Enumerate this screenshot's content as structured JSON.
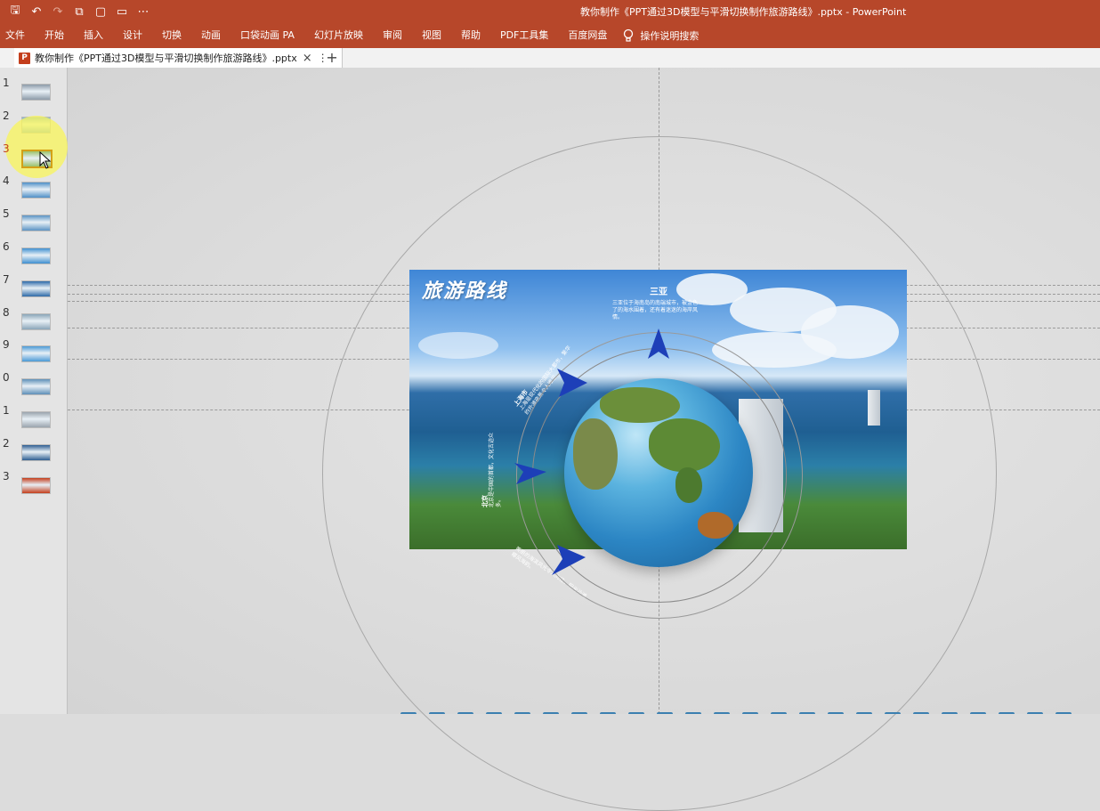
{
  "window": {
    "title": "教你制作《PPT通过3D模型与平滑切换制作旅游路线》.pptx  -  PowerPoint"
  },
  "quick_access": [
    {
      "name": "save-icon",
      "glyph": "🖫"
    },
    {
      "name": "undo-icon",
      "glyph": "↶"
    },
    {
      "name": "redo-icon",
      "glyph": "↷"
    },
    {
      "name": "slideshow-icon",
      "glyph": "⧉"
    },
    {
      "name": "new-icon",
      "glyph": "▢"
    },
    {
      "name": "open-icon",
      "glyph": "▭"
    },
    {
      "name": "customize-icon",
      "glyph": "⋯"
    }
  ],
  "ribbon": {
    "tabs": [
      "文件",
      "开始",
      "插入",
      "设计",
      "切换",
      "动画",
      "口袋动画 PA",
      "幻灯片放映",
      "审阅",
      "视图",
      "帮助",
      "PDF工具集",
      "百度网盘"
    ],
    "tell_me": "操作说明搜索"
  },
  "doc_tab": {
    "title": "教你制作《PPT通过3D模型与平滑切换制作旅游路线》.pptx",
    "close": "×",
    "more": "⋮",
    "new": "+",
    "icon_letter": "P"
  },
  "thumbnails": [
    {
      "num": "1",
      "color": "#8c9aa8"
    },
    {
      "num": "2",
      "color": "#7fb0d6"
    },
    {
      "num": "3",
      "color": "#9cc26a"
    },
    {
      "num": "4",
      "color": "#4f8fc7"
    },
    {
      "num": "5",
      "color": "#5b93c4"
    },
    {
      "num": "6",
      "color": "#3f8fd0"
    },
    {
      "num": "7",
      "color": "#2e6aa8"
    },
    {
      "num": "8",
      "color": "#8aa5b8"
    },
    {
      "num": "9",
      "color": "#4b9ad6"
    },
    {
      "num": "0",
      "color": "#5e8fb8"
    },
    {
      "num": "1",
      "color": "#9aa4ad"
    },
    {
      "num": "2",
      "color": "#2f5f92"
    },
    {
      "num": "3",
      "color": "#c43e1c"
    }
  ],
  "current_slide_index": 3,
  "slide": {
    "title": "旅游路线",
    "destination": "三亚",
    "destination_desc": "三亚位于海南岛的南端城市，被金色了的海水围着，还有着迷迷的海岸风情。",
    "left_label": "北京",
    "left_desc": "北京是中国的首都，文化古迹众多。",
    "upper_label": "上海市",
    "upper_desc": "上海是现代化的国际大都市，繁华的外滩夜景令人难忘。",
    "lower_desc": "美丽的海滨风光令人向往，阳光沙滩椰风海韵。"
  }
}
